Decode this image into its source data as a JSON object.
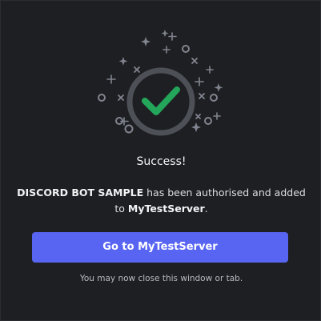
{
  "dialog": {
    "title": "Success!",
    "app_name": "DISCORD BOT SAMPLE",
    "message_mid": " has been authorised and added to ",
    "server_name": "MyTestServer",
    "message_end": ".",
    "button_label": "Go to MyTestServer",
    "hint": "You may now close this window or tab."
  },
  "icons": {
    "main": "check-circle-icon",
    "decor": [
      "sparkle-icon",
      "x-mark-icon",
      "ring-icon",
      "plus-icon"
    ]
  },
  "colors": {
    "background": "#1e1f22",
    "check": "#23a55a",
    "ring": "#4e5058",
    "button": "#5865f2",
    "decor": "#80848e"
  }
}
